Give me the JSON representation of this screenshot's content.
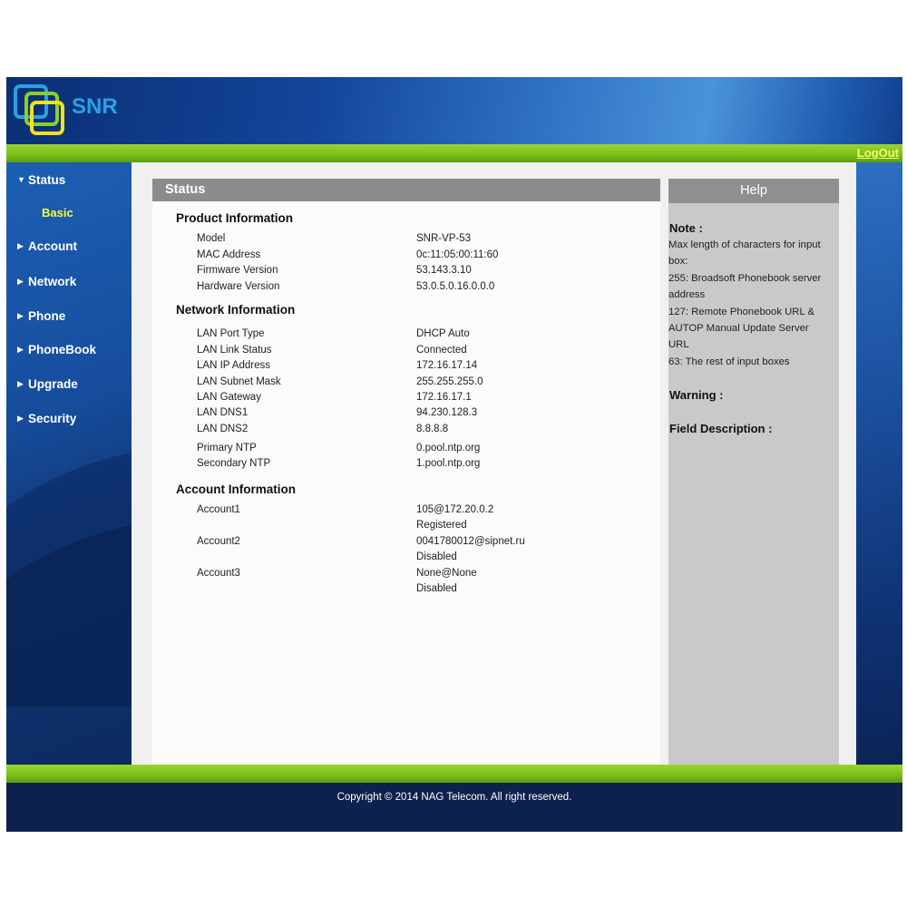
{
  "header": {
    "logo_text": "SNR",
    "logout": "LogOut"
  },
  "sidebar": {
    "items": [
      {
        "label": "Status",
        "expanded": true
      },
      {
        "label": "Account"
      },
      {
        "label": "Network"
      },
      {
        "label": "Phone"
      },
      {
        "label": "PhoneBook"
      },
      {
        "label": "Upgrade"
      },
      {
        "label": "Security"
      }
    ],
    "sub_selected": "Basic"
  },
  "main": {
    "title": "Status",
    "product": {
      "title": "Product Information",
      "rows": [
        {
          "label": "Model",
          "value": "SNR-VP-53"
        },
        {
          "label": "MAC Address",
          "value": "0c:11:05:00:11:60"
        },
        {
          "label": "Firmware Version",
          "value": "53.143.3.10"
        },
        {
          "label": "Hardware Version",
          "value": "53.0.5.0.16.0.0.0"
        }
      ]
    },
    "network": {
      "title": "Network Information",
      "rows": [
        {
          "label": "LAN Port Type",
          "value": "DHCP Auto"
        },
        {
          "label": "LAN Link Status",
          "value": "Connected"
        },
        {
          "label": "LAN IP Address",
          "value": "172.16.17.14"
        },
        {
          "label": "LAN Subnet Mask",
          "value": "255.255.255.0"
        },
        {
          "label": "LAN Gateway",
          "value": "172.16.17.1"
        },
        {
          "label": "LAN DNS1",
          "value": "94.230.128.3"
        },
        {
          "label": "LAN DNS2",
          "value": "8.8.8.8"
        },
        {
          "label": "Primary NTP",
          "value": "0.pool.ntp.org"
        },
        {
          "label": "Secondary NTP",
          "value": "1.pool.ntp.org"
        }
      ]
    },
    "account": {
      "title": "Account Information",
      "rows": [
        {
          "label": "Account1",
          "value": "105@172.20.0.2",
          "status": "Registered"
        },
        {
          "label": "Account2",
          "value": "0041780012@sipnet.ru",
          "status": "Disabled"
        },
        {
          "label": "Account3",
          "value": "None@None",
          "status": "Disabled"
        }
      ]
    }
  },
  "help": {
    "title": "Help",
    "note_title": "Note :",
    "note_lines": [
      "Max length of characters for input",
      "box:",
      "255: Broadsoft Phonebook server",
      "address",
      "127: Remote Phonebook URL &",
      "AUTOP Manual Update Server",
      "URL",
      "63: The rest of input boxes"
    ],
    "warning_title": "Warning :",
    "field_title": "Field Description :"
  },
  "footer": {
    "copyright": "Copyright © 2014 NAG Telecom. All right reserved."
  },
  "colors": {
    "green": "#7cc11b",
    "nav_sub": "#f2ff3a",
    "logout": "#f3ff6a"
  }
}
